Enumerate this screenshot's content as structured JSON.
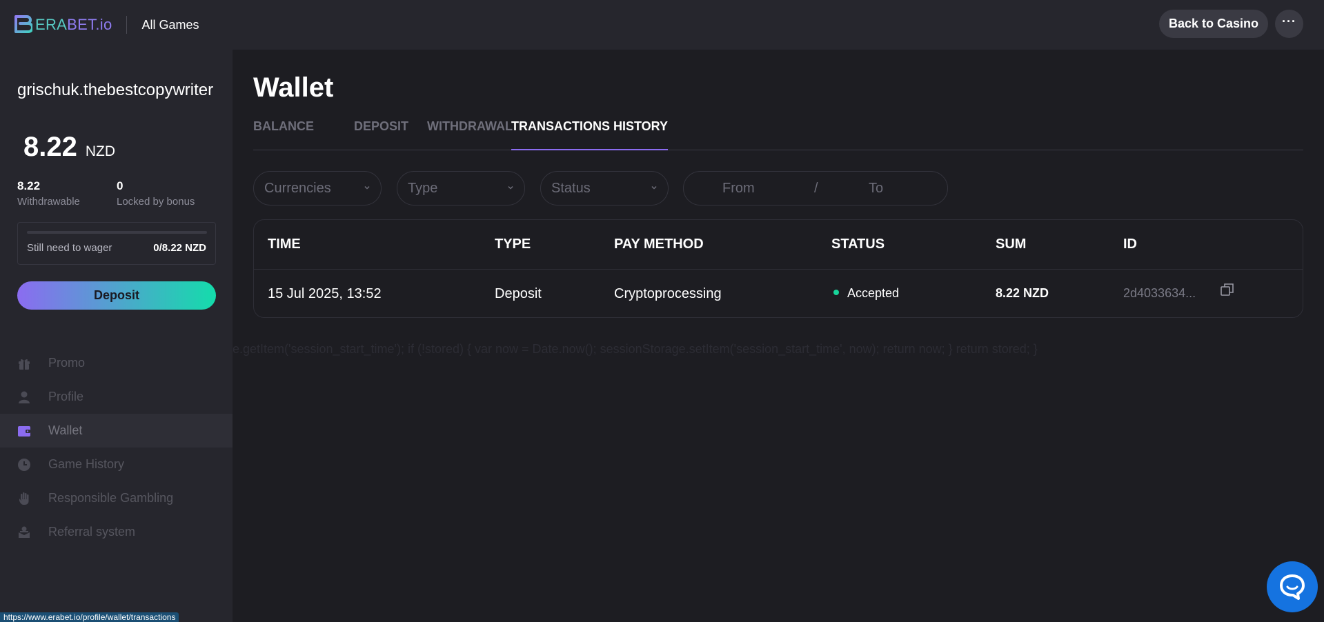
{
  "header": {
    "logo_part1": "ERA",
    "logo_part2": "BET.io",
    "all_games": "All Games",
    "back_to_casino": "Back to Casino",
    "more_label": "···"
  },
  "sidebar": {
    "username": "grischuk.thebestcopywriter",
    "balance_amount": "8.22",
    "balance_currency": "NZD",
    "withdrawable_value": "8.22",
    "withdrawable_label": "Withdrawable",
    "locked_value": "0",
    "locked_label": "Locked by bonus",
    "wager_label": "Still need to wager",
    "wager_value": "0/8.22 NZD",
    "wager_progress": 0,
    "deposit_label": "Deposit",
    "menu": [
      {
        "label": "Promo",
        "icon": "gift-icon"
      },
      {
        "label": "Profile",
        "icon": "user-icon"
      },
      {
        "label": "Wallet",
        "icon": "wallet-icon",
        "active": true
      },
      {
        "label": "Game History",
        "icon": "clock-icon"
      },
      {
        "label": "Responsible Gambling",
        "icon": "hand-icon"
      },
      {
        "label": "Referral system",
        "icon": "referral-icon"
      }
    ]
  },
  "main": {
    "title": "Wallet",
    "tabs": [
      {
        "label": "BALANCE"
      },
      {
        "label": "DEPOSIT"
      },
      {
        "label": "WITHDRAWAL"
      },
      {
        "label": "TRANSACTIONS HISTORY",
        "active": true
      }
    ],
    "filters": {
      "currencies": "Currencies",
      "type": "Type",
      "status": "Status",
      "from": "From",
      "separator": "/",
      "to": "To"
    },
    "table": {
      "columns": [
        "TIME",
        "TYPE",
        "PAY METHOD",
        "STATUS",
        "SUM",
        "ID"
      ],
      "rows": [
        {
          "time": "15 Jul 2025, 13:52",
          "type": "Deposit",
          "pay_method": "Cryptoprocessing",
          "status": "Accepted",
          "sum": "8.22 NZD",
          "id": "2d4033634..."
        }
      ]
    },
    "ghost_text": "e.getItem('session_start_time'); if (!stored) { var now = Date.now(); sessionStorage.setItem('session_start_time', now); return now; } return stored; }"
  },
  "status_bar": "https://www.erabet.io/profile/wallet/transactions",
  "colors": {
    "accent_purple": "#8b6cf0",
    "accent_green": "#14dcab",
    "status_accepted": "#18d49a",
    "chat_blue": "#1573e0"
  }
}
